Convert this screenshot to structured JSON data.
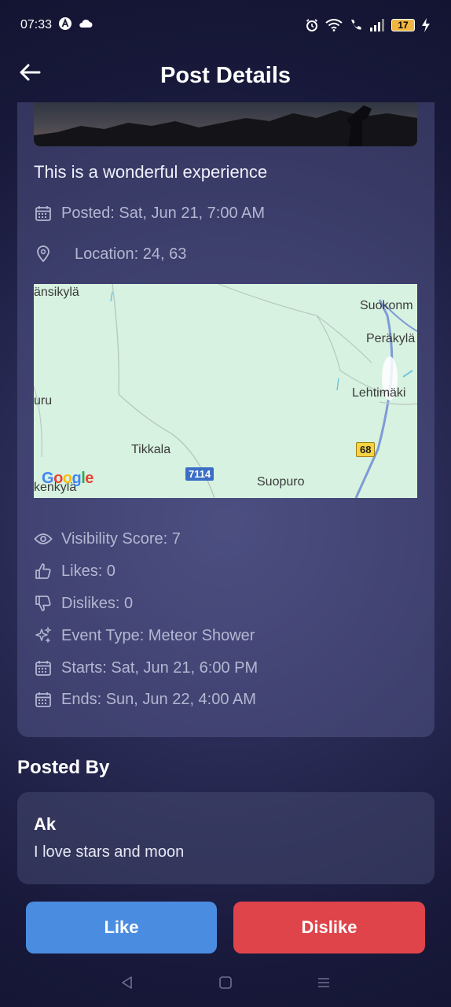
{
  "status_bar": {
    "time": "07:33",
    "battery": "17",
    "icons": [
      "app-a-icon",
      "cloud-icon",
      "alarm-icon",
      "wifi-icon",
      "wifi-call-icon",
      "signal-icon",
      "battery-icon",
      "charging-icon"
    ]
  },
  "header": {
    "title": "Post Details",
    "back_icon": "arrow-left-icon"
  },
  "post": {
    "text": "This is a wonderful experience",
    "posted": "Posted: Sat, Jun 21, 7:00 AM",
    "location": "Location: 24, 63",
    "map": {
      "labels": [
        "änsikylä",
        "Suokonm",
        "Peräkylä",
        "uru",
        "Lehtimäki",
        "Tikkala",
        "Suopuro",
        "kenkylä"
      ],
      "road_badges": [
        "7114",
        "68"
      ],
      "provider_logo": "Google"
    },
    "details": {
      "visibility": "Visibility Score: 7",
      "likes": "Likes: 0",
      "dislikes": "Dislikes: 0",
      "event_type": "Event Type: Meteor Shower",
      "starts": "Starts: Sat, Jun 21, 6:00 PM",
      "ends": "Ends: Sun, Jun 22, 4:00 AM"
    }
  },
  "posted_by": {
    "section_title": "Posted By",
    "name": "Ak",
    "bio": "I love stars and moon"
  },
  "actions": {
    "like_label": "Like",
    "dislike_label": "Dislike"
  },
  "colors": {
    "like": "#4a8de0",
    "dislike": "#de444a",
    "muted_text": "#b4b7d2"
  }
}
